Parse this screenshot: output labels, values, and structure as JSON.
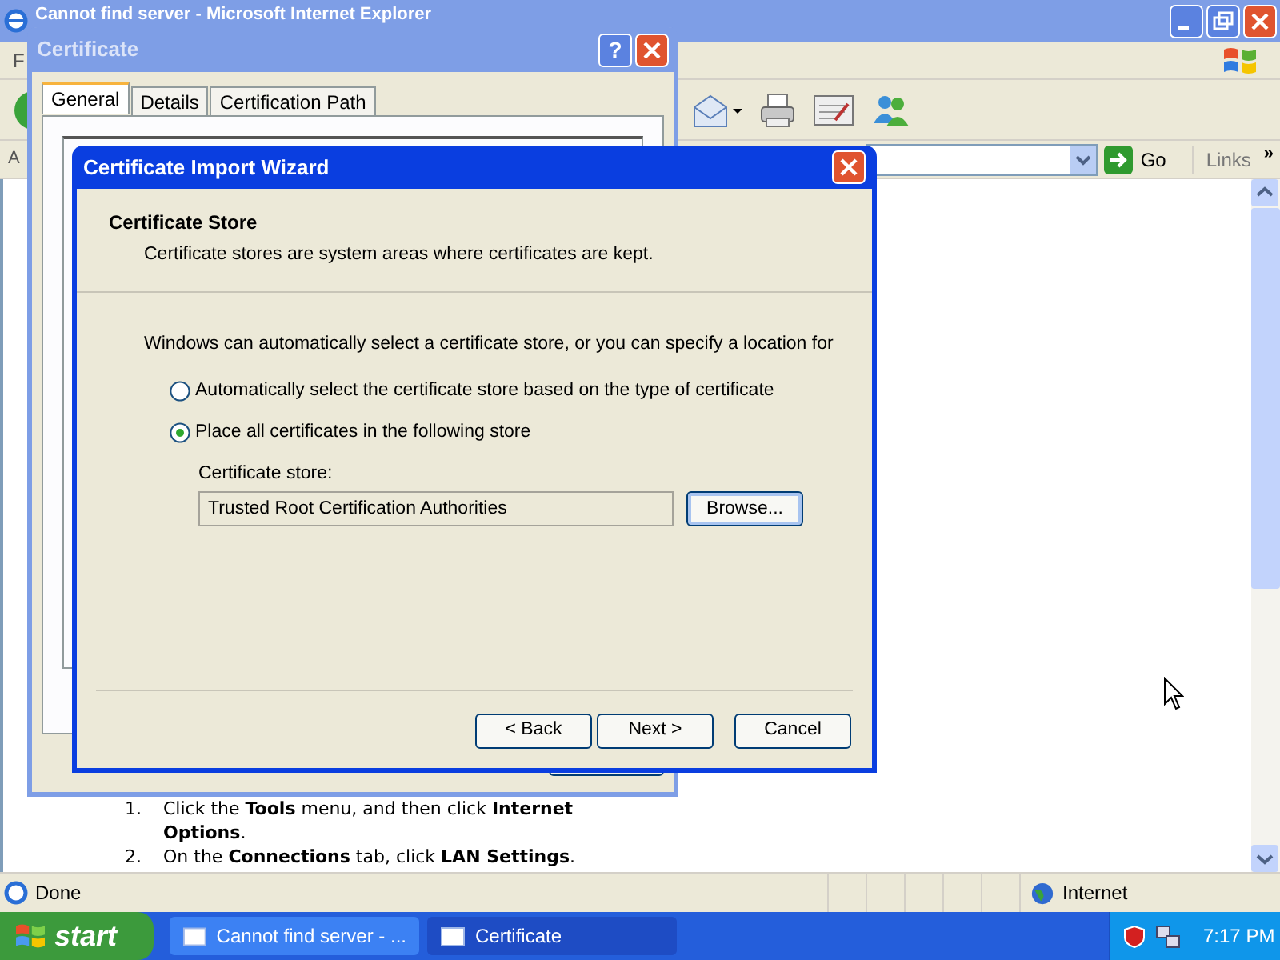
{
  "browser": {
    "title": "Cannot find server - Microsoft Internet Explorer",
    "menu_bar": [
      "F"
    ],
    "address_label": "A",
    "go": "Go",
    "links": "Links",
    "links_chevron": "»",
    "steps": [
      {
        "number": "1.",
        "text": "Click the **Tools** menu, and then click **Internet Options**."
      },
      {
        "number": "2.",
        "text": "On the **Connections** tab, click **LAN Settings**."
      }
    ],
    "status": {
      "text": "Done",
      "zone": "Internet"
    }
  },
  "certificate_dialog": {
    "title": "Certificate",
    "help": "?",
    "tabs": [
      {
        "label": "General",
        "selected": true
      },
      {
        "label": "Details",
        "selected": false
      },
      {
        "label": "Certification Path",
        "selected": false
      }
    ]
  },
  "wizard": {
    "title": "Certificate Import Wizard",
    "heading": "Certificate Store",
    "subheading": "Certificate stores are system areas where certificates are kept.",
    "intro": "Windows can automatically select a certificate store, or you can specify a location for",
    "options": [
      {
        "label": "Automatically select the certificate store based on the type of certificate",
        "selected": false
      },
      {
        "label": "Place all certificates in the following store",
        "selected": true
      }
    ],
    "store_label": "Certificate store:",
    "store_value": "Trusted Root Certification Authorities",
    "browse": "Browse...",
    "buttons": [
      "< Back",
      "Next >",
      "Cancel"
    ]
  },
  "taskbar": {
    "start": "start",
    "tasks": [
      {
        "label": "Cannot find server - ...",
        "selected": false
      },
      {
        "label": "Certificate",
        "selected": true
      }
    ],
    "clock": "7:17 PM"
  }
}
